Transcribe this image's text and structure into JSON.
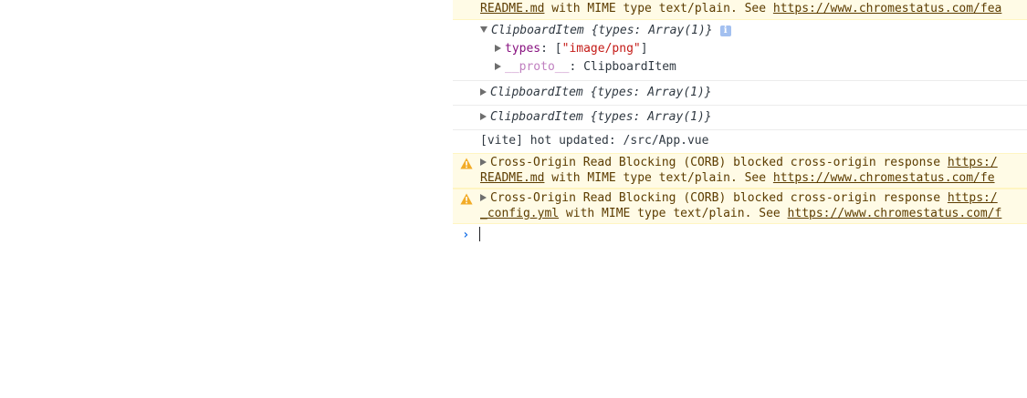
{
  "console": {
    "top_warning": {
      "file": "README.md",
      "text": " with MIME type text/plain. See ",
      "link": "https://www.chromestatus.com/fea"
    },
    "expanded_item": {
      "head": "ClipboardItem",
      "summary": "{types: Array(1)}",
      "info_badge": "i",
      "types_key": "types",
      "types_sep": ": [",
      "types_value": "\"image/png\"",
      "types_close": "]",
      "proto_key": "__proto__",
      "proto_sep": ": ",
      "proto_value": "ClipboardItem"
    },
    "items": [
      {
        "head": "ClipboardItem",
        "summary": "{types: Array(1)}"
      },
      {
        "head": "ClipboardItem",
        "summary": "{types: Array(1)}"
      }
    ],
    "vite_message": "[vite] hot updated: /src/App.vue",
    "warnings": [
      {
        "line1": "Cross-Origin Read Blocking (CORB) blocked cross-origin response ",
        "line1_link": "https:/",
        "file": "README.md",
        "text": " with MIME type text/plain. See ",
        "link": "https://www.chromestatus.com/fe"
      },
      {
        "line1": "Cross-Origin Read Blocking (CORB) blocked cross-origin response ",
        "line1_link": "https:/",
        "file": "_config.yml",
        "text": " with MIME type text/plain. See ",
        "link": "https://www.chromestatus.com/f"
      }
    ],
    "prompt_symbol": "›",
    "warning_icon": "warning-triangle-icon",
    "colors": {
      "warning_bg": "#fffbe6",
      "warning_text": "#5c3c00",
      "prompt": "#1a73e8",
      "string": "#c41a16",
      "key": "#881280"
    }
  }
}
